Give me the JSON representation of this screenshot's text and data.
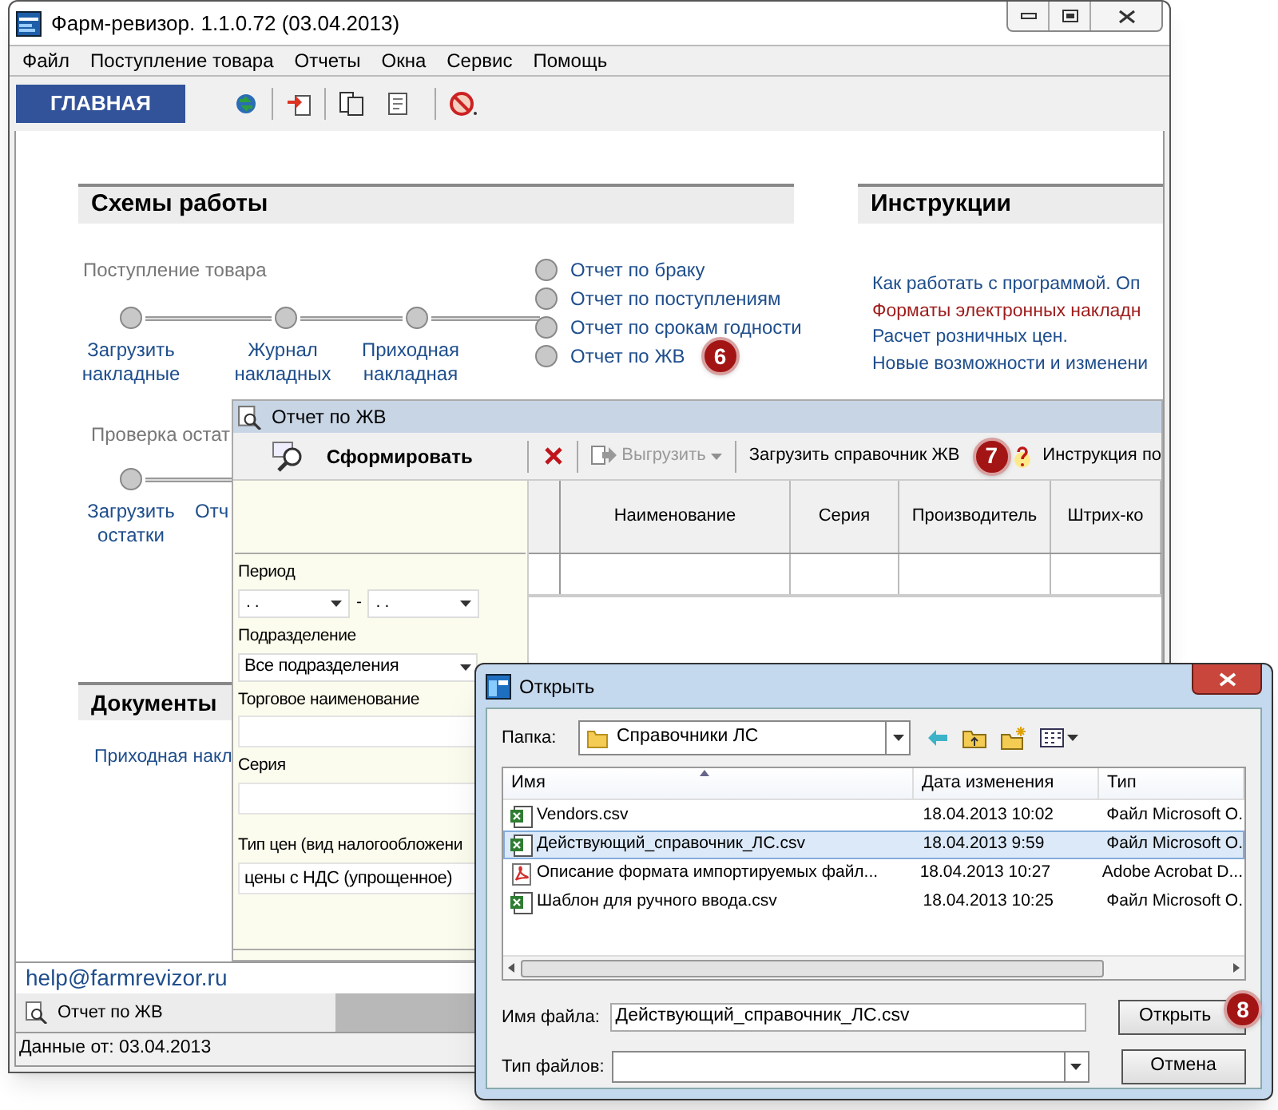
{
  "main_window": {
    "title": "Фарм-ревизор. 1.1.0.72 (03.04.2013)",
    "menu": [
      "Файл",
      "Поступление товара",
      "Отчеты",
      "Окна",
      "Сервис",
      "Помощь"
    ],
    "home_button": {
      "label": "ГЛАВНАЯ",
      "selected": true
    },
    "schemes": {
      "title": "Схемы работы",
      "receipt": {
        "label": "Поступление товара",
        "steps": [
          "Загрузить накладные",
          "Журнал накладных",
          "Приходная накладная"
        ],
        "reports": [
          {
            "text": "Отчет по браку"
          },
          {
            "text": "Отчет по поступлениям"
          },
          {
            "text": "Отчет по срокам годности"
          },
          {
            "text": "Отчет по ЖВ",
            "callout": "6"
          }
        ]
      },
      "check": {
        "label": "Проверка остат",
        "steps": [
          "Загрузить остатки",
          "Отч"
        ]
      }
    },
    "instructions": {
      "title": "Инструкции",
      "links": [
        {
          "text": "Как работать с программой. Оп",
          "color": "#1f4e8c"
        },
        {
          "text": "Форматы электронных накладн",
          "color": "#9e1b1b"
        },
        {
          "text": "Расчет розничных цен.",
          "color": "#1f4e8c"
        },
        {
          "text": "Новые возможности и изменени",
          "color": "#1f4e8c"
        }
      ]
    },
    "documents": {
      "title": "Документы",
      "links": [
        "Приходная накл"
      ]
    },
    "email": "help@farmrevizor.ru",
    "window_tabs": [
      {
        "label": "Отчет по ЖВ",
        "selected": true
      }
    ],
    "status": "Данные от: 03.04.2013"
  },
  "report_window": {
    "title": "Отчет по ЖВ",
    "toolbar": {
      "generate": "Сформировать",
      "export": {
        "label": "Выгрузить",
        "disabled": true
      },
      "load": "Загрузить справочник ЖВ",
      "callout": "7",
      "help": "Инструкция по"
    },
    "filters": [
      {
        "kind": "dates",
        "label": "Период",
        "from": ". .",
        "separator": "-",
        "to": ". ."
      },
      {
        "kind": "select",
        "label": "Подразделение",
        "value": "Все подразделения"
      },
      {
        "kind": "input",
        "label": "Торговое наименование"
      },
      {
        "kind": "input",
        "label": "Серия"
      },
      {
        "kind": "input",
        "label": "Тип цен (вид налогообложени",
        "value": "цены с НДС (упрощенное)"
      }
    ],
    "columns": [
      "Наименование",
      "Серия",
      "Производитель",
      "Штрих-ко"
    ]
  },
  "open_dialog": {
    "title": "Открыть",
    "folder_label": "Папка:",
    "folder": "Справочники ЛС",
    "columns": [
      "Имя",
      "Дата изменения",
      "Тип"
    ],
    "files": [
      {
        "name": "Vendors.csv",
        "date": "18.04.2013 10:02",
        "type": "Файл Microsoft O.",
        "kind": "csv",
        "selected": false
      },
      {
        "name": "Действующий_справочник_ЛС.csv",
        "date": "18.04.2013 9:59",
        "type": "Файл Microsoft O.",
        "kind": "csv",
        "selected": true
      },
      {
        "name": "Описание формата импортируемых файл...",
        "date": "18.04.2013 10:27",
        "type": "Adobe Acrobat D...",
        "kind": "pdf",
        "selected": false
      },
      {
        "name": "Шаблон для ручного ввода.csv",
        "date": "18.04.2013 10:25",
        "type": "Файл Microsoft O.",
        "kind": "csv",
        "selected": false
      }
    ],
    "filename_label": "Имя файла:",
    "filename": "Действующий_справочник_ЛС.csv",
    "filetype_label": "Тип файлов:",
    "open_button": {
      "label": "Открыть",
      "callout": "8"
    },
    "cancel_button": "Отмена"
  }
}
